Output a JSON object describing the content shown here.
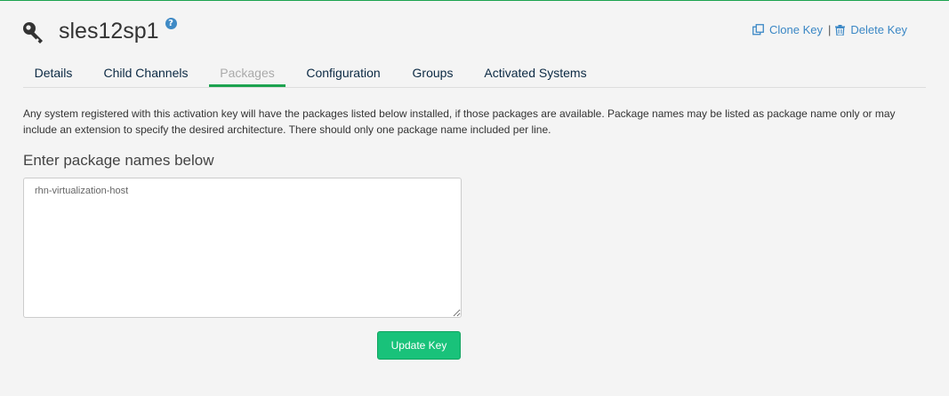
{
  "header": {
    "title": "sles12sp1",
    "help_glyph": "?",
    "icon": "key-icon"
  },
  "actions": {
    "clone_label": "Clone Key",
    "clone_icon": "clone-icon",
    "separator": "|",
    "delete_label": "Delete Key",
    "delete_icon": "trash-icon"
  },
  "tabs": [
    {
      "label": "Details",
      "active": false
    },
    {
      "label": "Child Channels",
      "active": false
    },
    {
      "label": "Packages",
      "active": true
    },
    {
      "label": "Configuration",
      "active": false
    },
    {
      "label": "Groups",
      "active": false
    },
    {
      "label": "Activated Systems",
      "active": false
    }
  ],
  "main": {
    "description": "Any system registered with this activation key will have the packages listed below installed, if those packages are available. Package names may be listed as package name only or may include an extension to specify the desired architecture. There should only one package name included per line.",
    "section_label": "Enter package names below",
    "packages_value": "rhn-virtualization-host",
    "update_label": "Update Key"
  },
  "colors": {
    "accent_green": "#1ca34f",
    "button_green": "#19c27a",
    "link_blue": "#3a87c5",
    "help_blue": "#3f8ac5",
    "background": "#f4f4f4"
  }
}
